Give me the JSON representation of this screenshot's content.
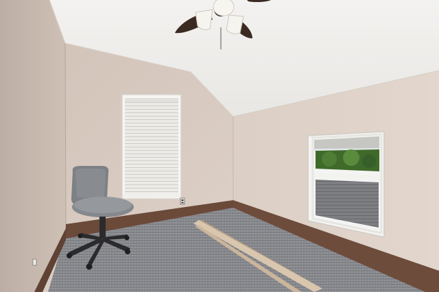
{
  "scene": {
    "kind": "empty bedroom with vaulted ceiling",
    "colors": {
      "ceiling": "#f1f0ee",
      "wall_left": "#c9bab0",
      "wall_back": "#d9cbc1",
      "wall_right": "#ddd0c6",
      "baseboard": "#6b4a3a",
      "carpet": "#8d8e92",
      "window_frame": "#f4f4f2",
      "blinds": "#e9e9e6",
      "chair_fabric": "#7d8084",
      "chair_base": "#2b2b2d",
      "fan_blade": "#3b2a22",
      "fan_light": "#f7f5ef",
      "trim_boards": "#d8c6ae",
      "foliage": "#3f6a2a",
      "roof_shingles": "#7a7c80"
    },
    "objects": [
      "ceiling-fan-with-lights",
      "window-with-blinds",
      "window-with-view",
      "office-chair",
      "trim-boards-on-floor",
      "wall-outlet"
    ]
  }
}
